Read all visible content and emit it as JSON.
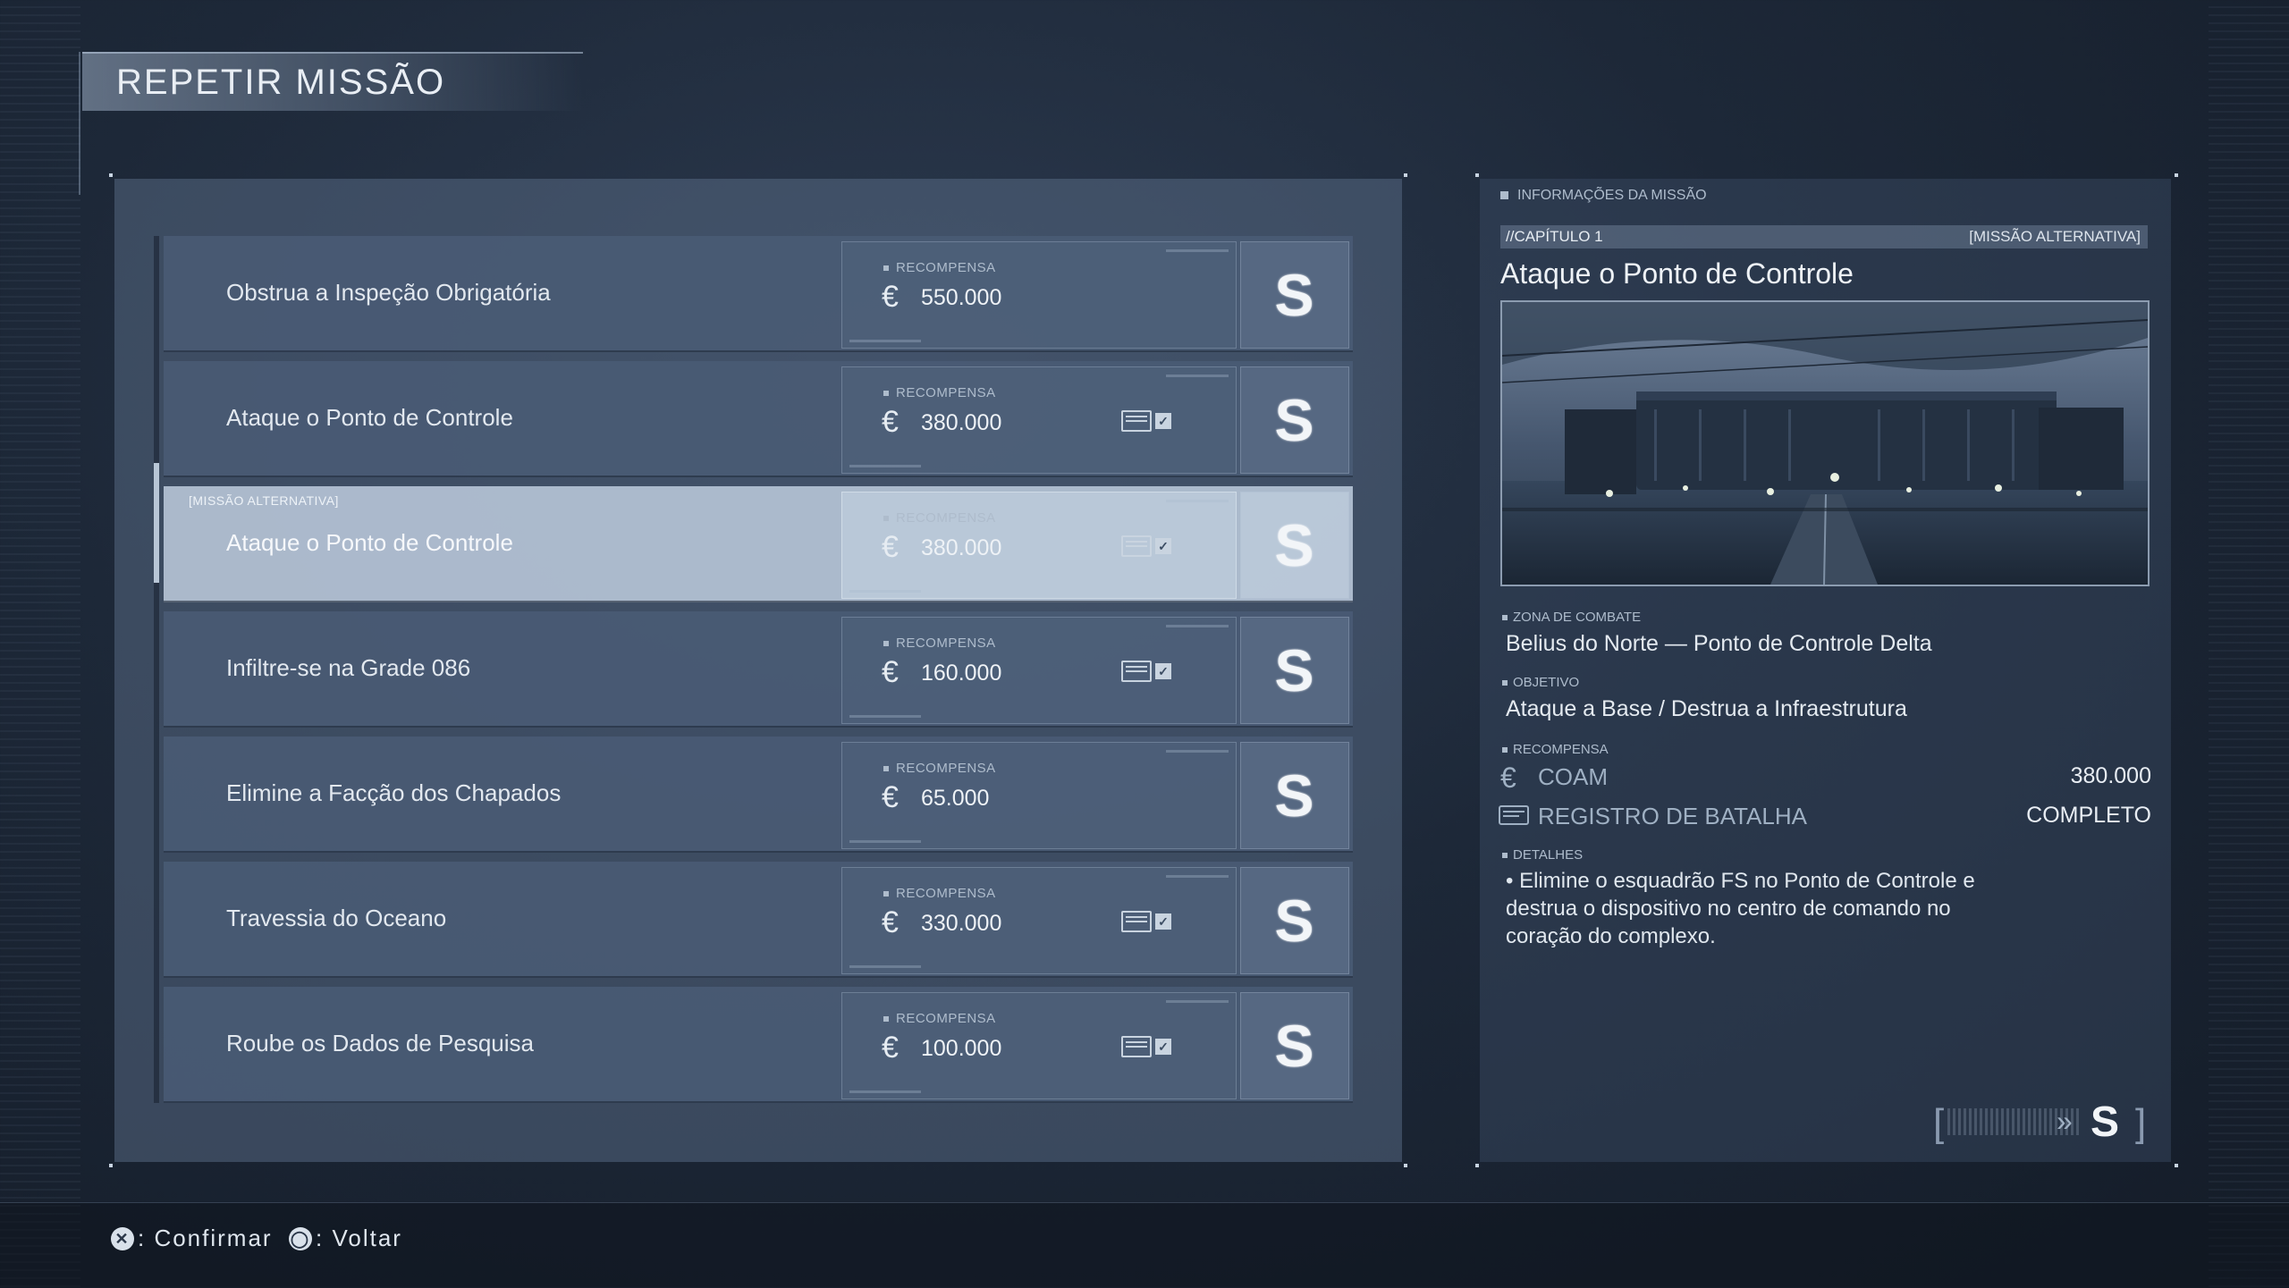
{
  "header": {
    "title": "REPETIR MISSÃO"
  },
  "missions": [
    {
      "name": "Obstrua a Inspeção Obrigatória",
      "reward_label": "RECOMPENSA",
      "currency": "€",
      "reward": "550.000",
      "rank": "S",
      "battle_log": false
    },
    {
      "name": "Ataque o Ponto de Controle",
      "reward_label": "RECOMPENSA",
      "currency": "€",
      "reward": "380.000",
      "rank": "S",
      "battle_log": true
    },
    {
      "name": "Ataque o Ponto de Controle",
      "reward_label": "RECOMPENSA",
      "currency": "€",
      "reward": "380.000",
      "rank": "S",
      "battle_log": true,
      "tag": "[MISSÃO ALTERNATIVA]",
      "selected": true
    },
    {
      "name": "Infiltre-se na Grade 086",
      "reward_label": "RECOMPENSA",
      "currency": "€",
      "reward": "160.000",
      "rank": "S",
      "battle_log": true
    },
    {
      "name": "Elimine a Facção dos Chapados",
      "reward_label": "RECOMPENSA",
      "currency": "€",
      "reward": "65.000",
      "rank": "S",
      "battle_log": false
    },
    {
      "name": "Travessia do Oceano",
      "reward_label": "RECOMPENSA",
      "currency": "€",
      "reward": "330.000",
      "rank": "S",
      "battle_log": true
    },
    {
      "name": "Roube os Dados de Pesquisa",
      "reward_label": "RECOMPENSA",
      "currency": "€",
      "reward": "100.000",
      "rank": "S",
      "battle_log": true
    }
  ],
  "info": {
    "header": "INFORMAÇÕES DA MISSÃO",
    "chapter": "//CAPÍTULO 1",
    "mission_type": "[MISSÃO ALTERNATIVA]",
    "title": "Ataque o Ponto de Controle",
    "combat_zone_label": "ZONA DE COMBATE",
    "combat_zone": "Belius do Norte — Ponto de Controle Delta",
    "objective_label": "OBJETIVO",
    "objective": "Ataque a Base / Destrua a Infraestrutura",
    "reward_label": "RECOMPENSA",
    "coam_symbol": "€",
    "coam_label": "COAM",
    "coam_value": "380.000",
    "battle_log_label": "REGISTRO DE BATALHA",
    "battle_log_value": "COMPLETO",
    "details_label": "DETALHES",
    "details": "• Elimine o esquadrão FS no Ponto de Controle e destrua o dispositivo no centro de comando no coração do complexo.",
    "best_rank": "S"
  },
  "controls": {
    "confirm_icon": "✕",
    "confirm_label": ": Confirmar",
    "back_icon": "◯",
    "back_label": ": Voltar"
  }
}
